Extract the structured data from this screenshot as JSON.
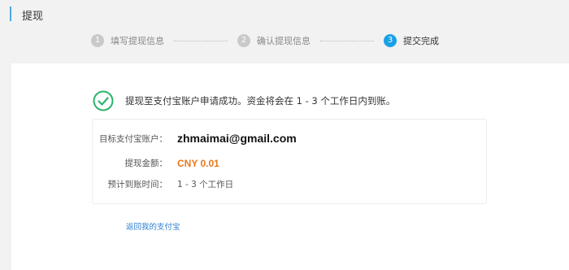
{
  "page": {
    "title": "提现"
  },
  "steps": [
    {
      "num": "1",
      "label": "填写提现信息"
    },
    {
      "num": "2",
      "label": "确认提现信息"
    },
    {
      "num": "3",
      "label": "提交完成"
    }
  ],
  "result": {
    "message": "提现至支付宝账户申请成功。资金将会在 1 - 3 个工作日内到账。",
    "icon": "success-check-icon",
    "accent_color": "#2db46c"
  },
  "details": {
    "account_label": "目标支付宝账户：",
    "account_value": "zhmaimai@gmail.com",
    "amount_label": "提现金额：",
    "amount_value": "CNY 0.01",
    "amount_color": "#e8781d",
    "eta_label": "预计到账时间：",
    "eta_value": "1 - 3 个工作日"
  },
  "links": {
    "back": "返回我的支付宝"
  }
}
